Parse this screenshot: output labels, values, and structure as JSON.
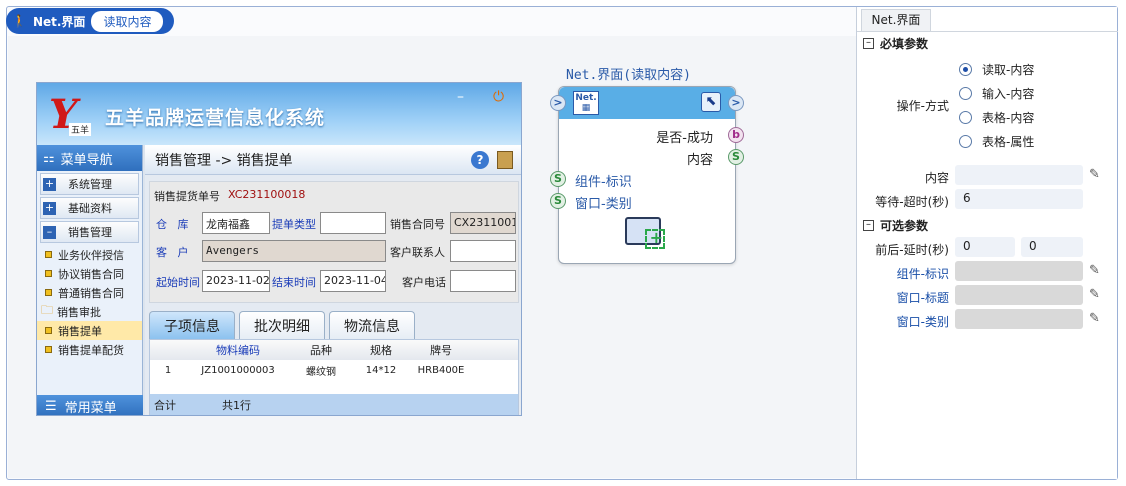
{
  "tab": {
    "name": "Net.界面",
    "action": "读取内容"
  },
  "node": {
    "title": "Net.界面(读取内容)",
    "net_icon_label": "Net.",
    "outputs": [
      {
        "type": "b",
        "label": "是否-成功"
      },
      {
        "type": "S",
        "label": "内容"
      }
    ],
    "inputs": [
      {
        "type": "S",
        "label": "组件-标识"
      },
      {
        "type": "S",
        "label": "窗口-类别"
      }
    ],
    "arrow": ">"
  },
  "screenshot": {
    "logo_letter": "Y",
    "logo_sub": "五羊",
    "app_title": "五羊品牌运营信息化系统",
    "nav_title": "菜单导航",
    "nav_groups": [
      "系统管理",
      "基础资料",
      "销售管理"
    ],
    "nav_items": [
      "业务伙伴授信",
      "协议销售合同",
      "普通销售合同",
      "销售审批",
      "销售提单",
      "销售提单配货"
    ],
    "nav_footer": "常用菜单",
    "main_title": "销售管理 -> 销售提单",
    "form": {
      "bill_label": "销售提货单号",
      "bill_value": "XC231100018",
      "warehouse_label": "仓   库",
      "warehouse_value": "龙南福鑫",
      "type_label": "提单类型",
      "contract_label": "销售合同号",
      "contract_value": "CX2311001",
      "customer_label": "客   户",
      "customer_value": "Avengers",
      "contact_label": "客户联系人",
      "start_label": "起始时间",
      "start_value": "2023-11-02",
      "end_label": "结束时间",
      "end_value": "2023-11-04",
      "phone_label": "客户电话"
    },
    "tabs": [
      "子项信息",
      "批次明细",
      "物流信息"
    ],
    "grid": {
      "headers": [
        "物料编码",
        "品种",
        "规格",
        "牌号"
      ],
      "rows": [
        [
          "1",
          "JZ1001000003",
          "螺纹钢",
          "14*12",
          "HRB400E"
        ]
      ],
      "footer_label": "合计",
      "footer_count": "共1行"
    }
  },
  "panel": {
    "tab": "Net.界面",
    "required_section": "必填参数",
    "op_label": "操作-方式",
    "op_options": [
      "读取-内容",
      "输入-内容",
      "表格-内容",
      "表格-属性"
    ],
    "op_selected": 0,
    "content_label": "内容",
    "content_value": "",
    "timeout_label": "等待-超时(秒)",
    "timeout_value": "6",
    "optional_section": "可选参数",
    "delay_label": "前后-延时(秒)",
    "delay_before": "0",
    "delay_after": "0",
    "component_label": "组件-标识",
    "window_title_label": "窗口-标题",
    "window_class_label": "窗口-类别"
  }
}
